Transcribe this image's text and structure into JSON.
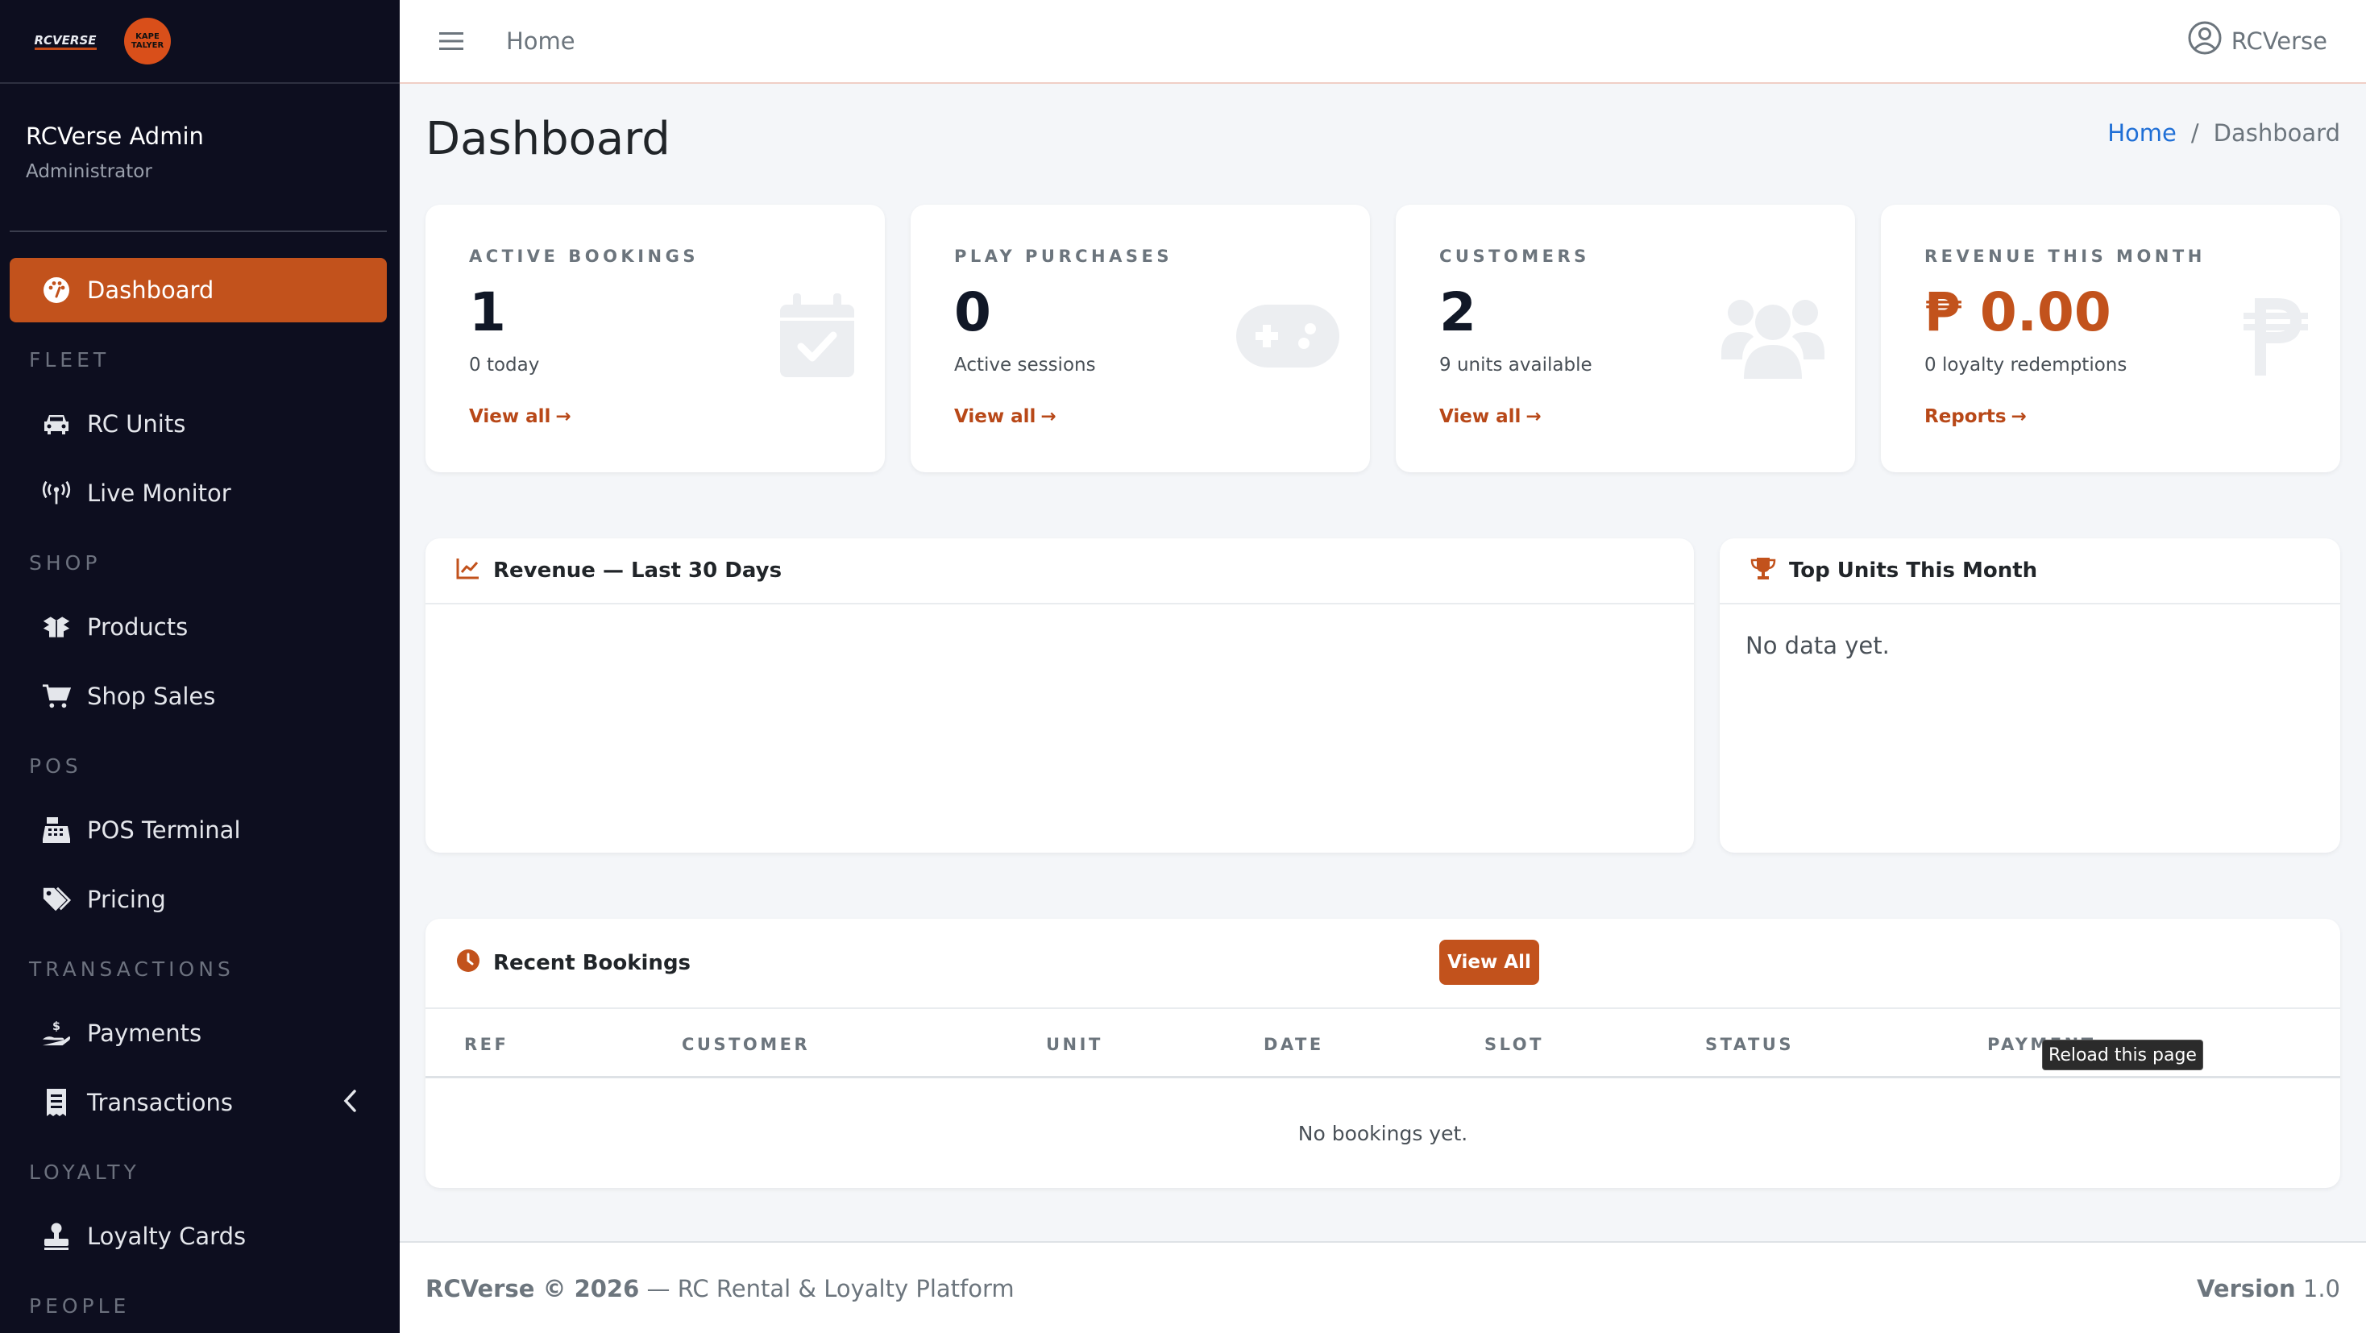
{
  "brand": {
    "logo1_text": "RCVERSE",
    "logo2_line1": "KAPE",
    "logo2_line2": "TALYER"
  },
  "user": {
    "name": "RCVerse Admin",
    "role": "Administrator"
  },
  "sidebar": {
    "items": [
      {
        "type": "item",
        "label": "Dashboard",
        "icon": "palette-icon",
        "active": true
      },
      {
        "type": "header",
        "label": "FLEET"
      },
      {
        "type": "item",
        "label": "RC Units",
        "icon": "car-icon"
      },
      {
        "type": "item",
        "label": "Live Monitor",
        "icon": "broadcast-icon"
      },
      {
        "type": "header",
        "label": "SHOP"
      },
      {
        "type": "item",
        "label": "Products",
        "icon": "boxes-icon"
      },
      {
        "type": "item",
        "label": "Shop Sales",
        "icon": "cart-icon"
      },
      {
        "type": "header",
        "label": "POS"
      },
      {
        "type": "item",
        "label": "POS Terminal",
        "icon": "cash-register-icon"
      },
      {
        "type": "item",
        "label": "Pricing",
        "icon": "tags-icon"
      },
      {
        "type": "header",
        "label": "TRANSACTIONS"
      },
      {
        "type": "item",
        "label": "Payments",
        "icon": "hand-dollar-icon"
      },
      {
        "type": "item",
        "label": "Transactions",
        "icon": "receipt-icon",
        "chevron": true
      },
      {
        "type": "header",
        "label": "LOYALTY"
      },
      {
        "type": "item",
        "label": "Loyalty Cards",
        "icon": "stamp-icon"
      },
      {
        "type": "header",
        "label": "PEOPLE"
      }
    ]
  },
  "topbar": {
    "home_link": "Home",
    "user_label": "RCVerse"
  },
  "page": {
    "title": "Dashboard"
  },
  "breadcrumb": {
    "home": "Home",
    "sep": "/",
    "current": "Dashboard"
  },
  "stats": [
    {
      "label": "ACTIVE BOOKINGS",
      "value": "1",
      "sub": "0 today",
      "link": "View all",
      "icon": "calendar-check-icon"
    },
    {
      "label": "PLAY PURCHASES",
      "value": "0",
      "sub": "Active sessions",
      "link": "View all",
      "icon": "gamepad-icon"
    },
    {
      "label": "CUSTOMERS",
      "value": "2",
      "sub": "9 units available",
      "link": "View all",
      "icon": "users-icon"
    },
    {
      "label": "REVENUE THIS MONTH",
      "value": "₱ 0.00",
      "sub": "0 loyalty redemptions",
      "link": "Reports",
      "icon": "peso-icon"
    }
  ],
  "revenue_panel": {
    "title": "Revenue — Last 30 Days"
  },
  "top_units_panel": {
    "title": "Top Units This Month",
    "empty": "No data yet."
  },
  "bookings_panel": {
    "title": "Recent Bookings",
    "button": "View All",
    "columns": [
      "REF",
      "CUSTOMER",
      "UNIT",
      "DATE",
      "SLOT",
      "STATUS",
      "PAYMENT"
    ],
    "empty": "No bookings yet."
  },
  "tooltip": "Reload this page",
  "footer": {
    "brand": "RCVerse © 2026",
    "tagline": " — RC Rental & Loyalty Platform",
    "version_label": "Version",
    "version": "1.0"
  },
  "colors": {
    "accent": "#c2521c",
    "sidebar_bg": "#0d0e1f",
    "link": "#1f6fd6"
  }
}
